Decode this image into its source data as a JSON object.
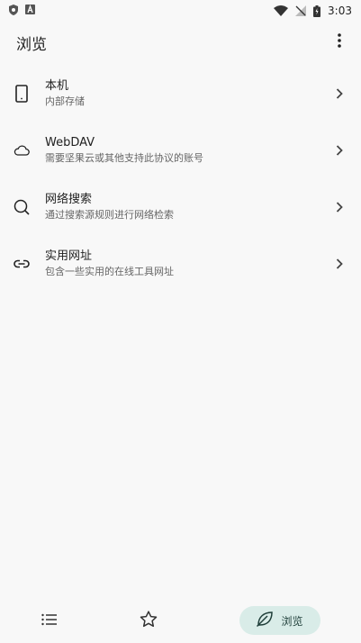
{
  "status_bar": {
    "time": "3:03"
  },
  "app_bar": {
    "title": "浏览"
  },
  "list": [
    {
      "icon": "phone-icon",
      "title": "本机",
      "subtitle": "内部存储"
    },
    {
      "icon": "cloud-icon",
      "title": "WebDAV",
      "subtitle": "需要坚果云或其他支持此协议的账号"
    },
    {
      "icon": "search-icon",
      "title": "网络搜索",
      "subtitle": "通过搜索源规则进行网络检索"
    },
    {
      "icon": "link-icon",
      "title": "实用网址",
      "subtitle": "包含一些实用的在线工具网址"
    }
  ],
  "bottom_nav": {
    "items": [
      {
        "icon": "list-icon",
        "label": ""
      },
      {
        "icon": "star-icon",
        "label": ""
      },
      {
        "icon": "leaf-icon",
        "label": "浏览"
      }
    ],
    "active_color": "#d9ece8"
  }
}
